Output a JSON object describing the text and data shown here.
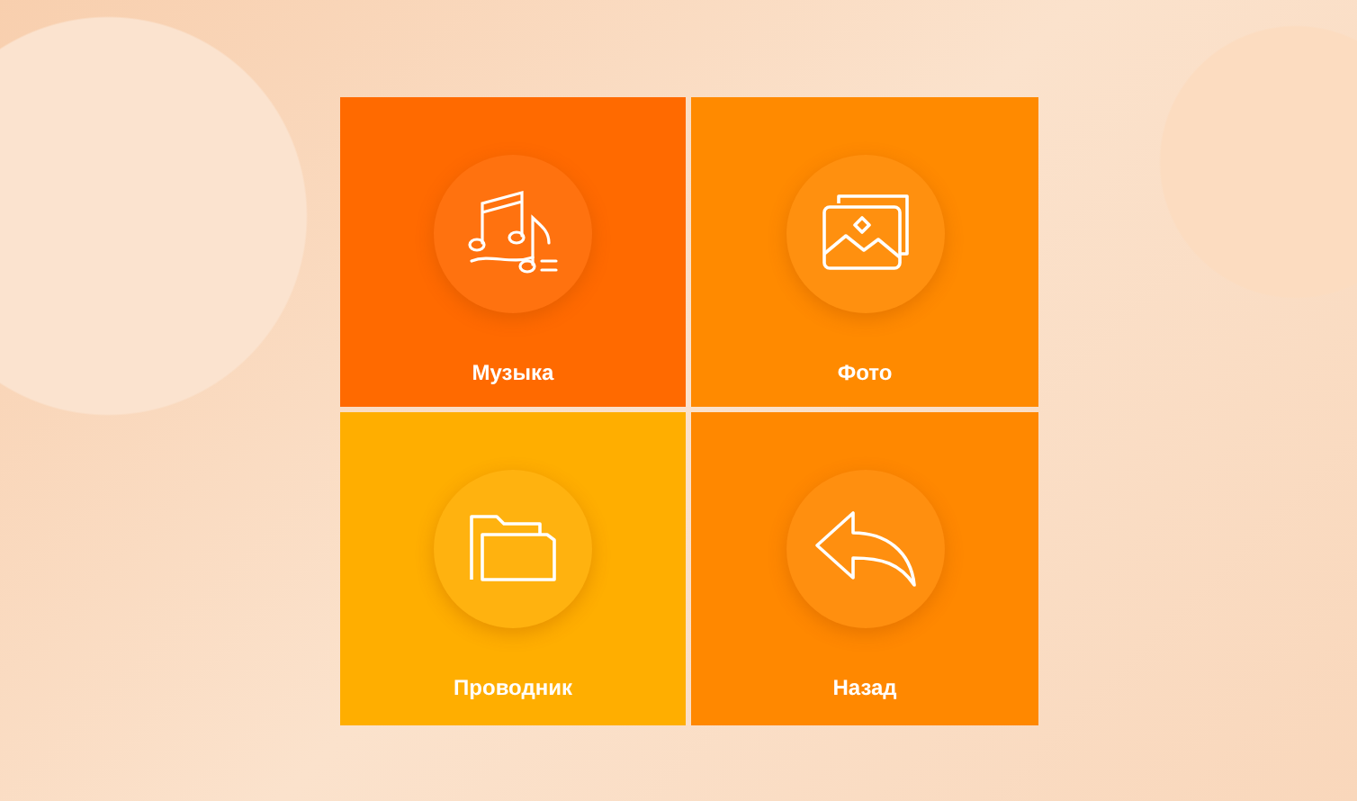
{
  "tiles": [
    {
      "label": "Музыка",
      "kind": "music",
      "color": "#ff6a00"
    },
    {
      "label": "Фото",
      "kind": "photo",
      "color": "#ff8a00"
    },
    {
      "label": "Проводник",
      "kind": "folder",
      "color": "#ffae00"
    },
    {
      "label": "Назад",
      "kind": "back",
      "color": "#ff8800"
    }
  ]
}
